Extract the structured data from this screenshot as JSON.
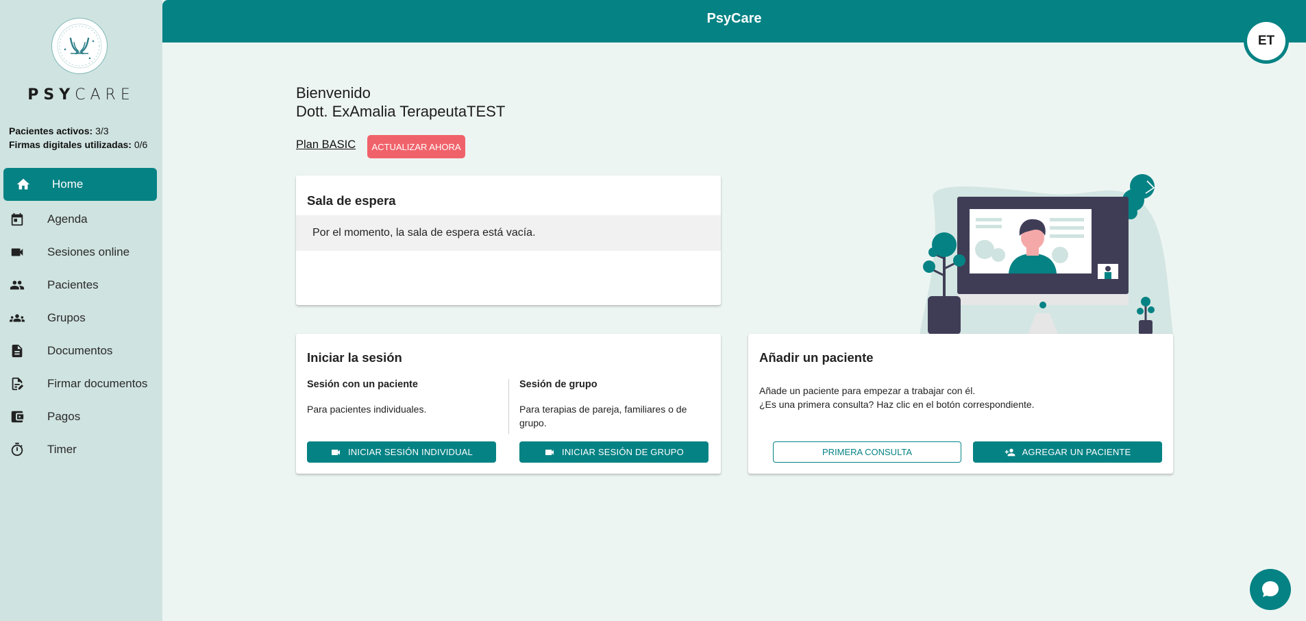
{
  "app": {
    "header_title": "PsyCare",
    "brand_bold": "PSY",
    "brand_light": "CARE",
    "avatar_initials": "ET"
  },
  "stats": {
    "active_label": "Pacientes activos:",
    "active_value": "3/3",
    "signatures_label": "Firmas digitales utilizadas:",
    "signatures_value": "0/6"
  },
  "sidebar": {
    "items": [
      {
        "label": "Home",
        "icon": "home-icon",
        "active": true
      },
      {
        "label": "Agenda",
        "icon": "calendar-icon"
      },
      {
        "label": "Sesiones online",
        "icon": "video-camera-icon"
      },
      {
        "label": "Pacientes",
        "icon": "people-icon"
      },
      {
        "label": "Grupos",
        "icon": "groups-icon"
      },
      {
        "label": "Documentos",
        "icon": "document-icon"
      },
      {
        "label": "Firmar documentos",
        "icon": "sign-document-icon"
      },
      {
        "label": "Pagos",
        "icon": "wallet-icon"
      },
      {
        "label": "Timer",
        "icon": "timer-icon"
      }
    ]
  },
  "welcome": {
    "line1": "Bienvenido",
    "line2": "Dott. ExAmalia TerapeutaTEST",
    "plan_link": "Plan BASIC",
    "upgrade_button": "ACTUALIZAR AHORA"
  },
  "waiting_room": {
    "title": "Sala de espera",
    "empty_message": "Por el momento, la sala de espera está vacía."
  },
  "session": {
    "title": "Iniciar la sesión",
    "individual_title": "Sesión con un paciente",
    "individual_desc": "Para pacientes individuales.",
    "individual_button": "INICIAR SESIÓN INDIVIDUAL",
    "group_title": "Sesión de grupo",
    "group_desc": "Para terapias de pareja, familiares o de grupo.",
    "group_button": "INICIAR SESIÓN DE GRUPO"
  },
  "add_patient": {
    "title": "Añadir un paciente",
    "desc_line1": "Añade un paciente para empezar a trabajar con él.",
    "desc_line2": "¿Es una primera consulta? Haz clic en el botón correspondiente.",
    "first_consult_button": "PRIMERA CONSULTA",
    "add_button": "AGREGAR UN PACIENTE"
  },
  "colors": {
    "primary": "#058284",
    "sidebar_bg": "#cfe3e0",
    "page_bg": "#edf5f2",
    "upgrade": "#f0626a"
  }
}
